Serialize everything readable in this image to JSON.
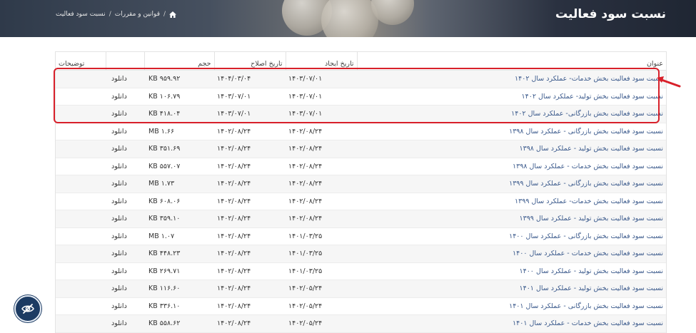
{
  "header": {
    "title": "نسبت سود فعالیت",
    "breadcrumb": [
      "قوانین و مقررات",
      "نسبت سود فعالیت"
    ]
  },
  "table": {
    "columns": {
      "title": "عنوان",
      "created": "تاریخ ایجاد",
      "modified": "تاریخ اصلاح",
      "size": "حجم",
      "notes": "توضیحات"
    },
    "rows": [
      {
        "title": "نسبت سود فعالیت بخش خدمات- عملکرد سال ۱۴۰۲",
        "created": "۱۴۰۳/۰۷/۰۱",
        "modified": "۱۴۰۴/۰۳/۰۴",
        "size": "KB ۹۵۹.۹۲",
        "download": "دانلود"
      },
      {
        "title": "نسبت سود فعالیت بخش تولید- عملکرد سال ۱۴۰۲",
        "created": "۱۴۰۳/۰۷/۰۱",
        "modified": "۱۴۰۳/۰۷/۰۱",
        "size": "KB ۱۰۶.۷۹",
        "download": "دانلود"
      },
      {
        "title": "نسبت سود فعالیت بخش بازرگانی- عملکرد سال ۱۴۰۲",
        "created": "۱۴۰۳/۰۷/۰۱",
        "modified": "۱۴۰۳/۰۷/۰۱",
        "size": "KB ۴۱۸.۰۴",
        "download": "دانلود"
      },
      {
        "title": "نسبت سود فعالیت بخش بازرگانی - عملکرد سال ۱۳۹۸",
        "created": "۱۴۰۲/۰۸/۲۴",
        "modified": "۱۴۰۲/۰۸/۲۴",
        "size": "MB ۱.۶۶",
        "download": "دانلود"
      },
      {
        "title": "نسبت سود فعالیت بخش تولید - عملکرد سال ۱۳۹۸",
        "created": "۱۴۰۲/۰۸/۲۴",
        "modified": "۱۴۰۲/۰۸/۲۴",
        "size": "KB ۳۵۱.۶۹",
        "download": "دانلود"
      },
      {
        "title": "نسبت سود فعالیت بخش خدمات - عملکرد سال ۱۳۹۸",
        "created": "۱۴۰۲/۰۸/۲۴",
        "modified": "۱۴۰۲/۰۸/۲۴",
        "size": "KB ۵۵۷.۰۷",
        "download": "دانلود"
      },
      {
        "title": "نسبت سود فعالیت بخش بازرگانی - عملکرد سال ۱۳۹۹",
        "created": "۱۴۰۲/۰۸/۲۴",
        "modified": "۱۴۰۲/۰۸/۲۴",
        "size": "MB ۱.۷۳",
        "download": "دانلود"
      },
      {
        "title": "نسبت سود فعالیت بخش خدمات- عملکرد سال ۱۳۹۹",
        "created": "۱۴۰۲/۰۸/۲۴",
        "modified": "۱۴۰۲/۰۸/۲۴",
        "size": "KB ۶۰۸.۰۶",
        "download": "دانلود"
      },
      {
        "title": "نسبت سود فعالیت بخش تولید - عملکرد سال ۱۳۹۹",
        "created": "۱۴۰۲/۰۸/۲۴",
        "modified": "۱۴۰۲/۰۸/۲۴",
        "size": "KB ۳۵۹.۱۰",
        "download": "دانلود"
      },
      {
        "title": "نسبت سود فعالیت بخش بازرگانی - عملکرد سال ۱۴۰۰",
        "created": "۱۴۰۱/۰۳/۲۵",
        "modified": "۱۴۰۲/۰۸/۲۴",
        "size": "MB ۱.۰۷",
        "download": "دانلود"
      },
      {
        "title": "نسبت سود فعالیت بخش خدمات - عملکرد سال ۱۴۰۰",
        "created": "۱۴۰۱/۰۳/۲۵",
        "modified": "۱۴۰۲/۰۸/۲۴",
        "size": "KB ۴۴۸.۲۳",
        "download": "دانلود"
      },
      {
        "title": "نسبت سود فعالیت بخش تولید - عملکرد سال ۱۴۰۰",
        "created": "۱۴۰۱/۰۳/۲۵",
        "modified": "۱۴۰۲/۰۸/۲۴",
        "size": "KB ۲۶۹.۷۱",
        "download": "دانلود"
      },
      {
        "title": "نسبت سود فعالیت بخش تولید - عملکرد سال ۱۴۰۱",
        "created": "۱۴۰۲/۰۵/۲۴",
        "modified": "۱۴۰۲/۰۸/۲۴",
        "size": "KB ۱۱۶.۶۰",
        "download": "دانلود"
      },
      {
        "title": "نسبت سود فعالیت بخش بازرگانی - عملکرد سال ۱۴۰۱",
        "created": "۱۴۰۲/۰۵/۲۴",
        "modified": "۱۴۰۲/۰۸/۲۴",
        "size": "KB ۳۳۶.۱۰",
        "download": "دانلود"
      },
      {
        "title": "نسبت سود فعالیت بخش خدمات - عملکرد سال ۱۴۰۱",
        "created": "۱۴۰۲/۰۵/۲۴",
        "modified": "۱۴۰۲/۰۸/۲۴",
        "size": "KB ۵۵۸.۶۲",
        "download": "دانلود"
      }
    ]
  },
  "colors": {
    "accent": "#d8202a",
    "link": "#3b5a8c",
    "fab": "#1c3b63"
  },
  "icons": {
    "home": "home-icon",
    "fab": "eye-slash-icon",
    "arrow": "arrow-pointer-icon"
  }
}
